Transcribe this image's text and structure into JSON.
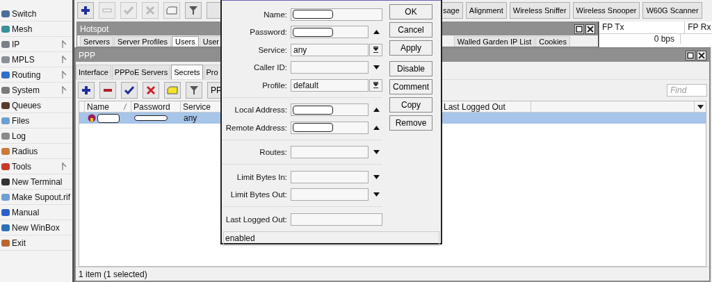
{
  "sidebar": {
    "items": [
      {
        "label": "Switch",
        "submenu": false
      },
      {
        "label": "Mesh",
        "submenu": false
      },
      {
        "label": "IP",
        "submenu": true
      },
      {
        "label": "MPLS",
        "submenu": true
      },
      {
        "label": "Routing",
        "submenu": true
      },
      {
        "label": "System",
        "submenu": true
      },
      {
        "label": "Queues",
        "submenu": false
      },
      {
        "label": "Files",
        "submenu": false
      },
      {
        "label": "Log",
        "submenu": false
      },
      {
        "label": "Radius",
        "submenu": false
      },
      {
        "label": "Tools",
        "submenu": true
      },
      {
        "label": "New Terminal",
        "submenu": false
      },
      {
        "label": "Make Supout.rif",
        "submenu": false
      },
      {
        "label": "Manual",
        "submenu": false
      },
      {
        "label": "New WinBox",
        "submenu": false
      },
      {
        "label": "Exit",
        "submenu": false
      }
    ]
  },
  "top_toolbar": {
    "icon_buttons": [
      {
        "kind": "add",
        "disabled": false
      },
      {
        "kind": "remove",
        "disabled": true
      },
      {
        "kind": "enable",
        "disabled": true
      },
      {
        "kind": "disable",
        "disabled": true
      },
      {
        "kind": "comment",
        "disabled": true
      },
      {
        "kind": "filter",
        "disabled": false
      }
    ],
    "text_buttons": [
      "sage",
      "Alignment",
      "Wireless Sniffer",
      "Wireless Snooper",
      "W60G Scanner"
    ]
  },
  "hotspot_window": {
    "title": "Hotspot",
    "tabs": [
      {
        "label": "Servers",
        "selected": false
      },
      {
        "label": "Server Profiles",
        "selected": false
      },
      {
        "label": "Users",
        "selected": true
      },
      {
        "label": "User",
        "selected": false
      }
    ],
    "more_tabs": [
      {
        "label": "Walled Garden IP List",
        "selected": false
      },
      {
        "label": "Cookies",
        "selected": false
      }
    ]
  },
  "traffic_panel": {
    "columns": [
      "FP Tx",
      "FP Rx"
    ],
    "value": "0 bps"
  },
  "ppp_window": {
    "title": "PPP",
    "tabs": [
      {
        "label": "Interface",
        "selected": false
      },
      {
        "label": "PPPoE Servers",
        "selected": false
      },
      {
        "label": "Secrets",
        "selected": true
      },
      {
        "label": "Pro",
        "selected": false
      }
    ],
    "toolbar": [
      {
        "kind": "add",
        "disabled": false
      },
      {
        "kind": "remove",
        "disabled": false
      },
      {
        "kind": "enable",
        "disabled": false
      },
      {
        "kind": "disable",
        "disabled": false
      },
      {
        "kind": "comment",
        "disabled": false
      },
      {
        "kind": "filter",
        "disabled": false
      }
    ],
    "text_button": "PP",
    "find": {
      "placeholder": "Find"
    },
    "table": {
      "columns": [
        {
          "label": "Name",
          "sorted": true
        },
        {
          "label": "Password",
          "sorted": false
        },
        {
          "label": "Service",
          "sorted": false
        },
        {
          "label": "Last Logged Out",
          "sorted": false
        }
      ],
      "rows": [
        {
          "selected": true,
          "name_redacted": true,
          "password_redacted": true,
          "service": "any"
        }
      ]
    },
    "status_bar": "1 item (1 selected)"
  },
  "dialog": {
    "groups": [
      [
        {
          "label": "Name:",
          "redacted": true,
          "kind": "plain"
        },
        {
          "label": "Password:",
          "redacted": true,
          "kind": "collapse"
        },
        {
          "label": "Service:",
          "value": "any",
          "redacted": false,
          "kind": "combo"
        },
        {
          "label": "Caller ID:",
          "redacted": false,
          "kind": "expand"
        },
        {
          "label": "Profile:",
          "value": "default",
          "redacted": false,
          "kind": "combo"
        }
      ],
      [
        {
          "label": "Local Address:",
          "redacted": true,
          "kind": "collapse"
        },
        {
          "label": "Remote Address:",
          "redacted": true,
          "kind": "collapse"
        }
      ],
      [
        {
          "label": "Routes:",
          "redacted": false,
          "kind": "expand"
        }
      ],
      [
        {
          "label": "Limit Bytes In:",
          "redacted": false,
          "kind": "expand"
        },
        {
          "label": "Limit Bytes Out:",
          "redacted": false,
          "kind": "expand"
        }
      ],
      [
        {
          "label": "Last Logged Out:",
          "redacted": false,
          "kind": "plain"
        }
      ]
    ],
    "button_groups": [
      [
        "OK",
        "Cancel",
        "Apply"
      ],
      [
        "Disable",
        "Comment",
        "Copy",
        "Remove"
      ]
    ],
    "status": "enabled"
  }
}
